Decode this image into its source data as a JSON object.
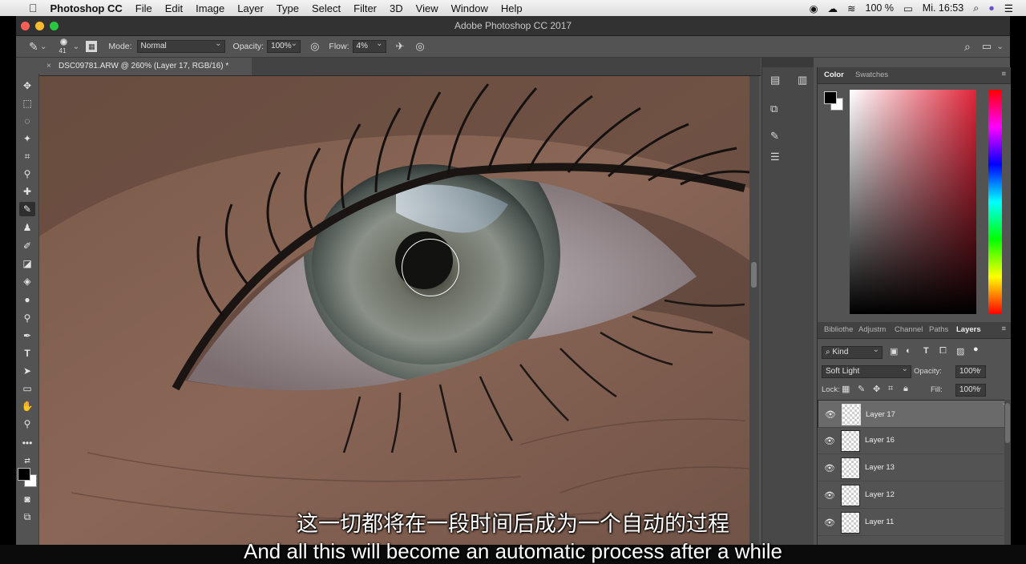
{
  "menubar": {
    "app": "Photoshop CC",
    "items": [
      "File",
      "Edit",
      "Image",
      "Layer",
      "Type",
      "Select",
      "Filter",
      "3D",
      "View",
      "Window",
      "Help"
    ],
    "battery": "100 %",
    "clock": "Mi. 16:53"
  },
  "window": {
    "title": "Adobe Photoshop CC 2017"
  },
  "options": {
    "brush_size": "41",
    "mode_label": "Mode:",
    "mode_value": "Normal",
    "opacity_label": "Opacity:",
    "opacity_value": "100%",
    "flow_label": "Flow:",
    "flow_value": "4%"
  },
  "document": {
    "tab_label": "DSC09781.ARW @ 260% (Layer 17, RGB/16) *"
  },
  "color_panel": {
    "tabs": [
      "Color",
      "Swatches"
    ]
  },
  "layers_panel": {
    "tabs": [
      "Bibliothe",
      "Adjustm",
      "Channel",
      "Paths",
      "Layers"
    ],
    "filter_label": "Kind",
    "blend_mode": "Soft Light",
    "opacity_label": "Opacity:",
    "opacity_value": "100%",
    "lock_label": "Lock:",
    "fill_label": "Fill:",
    "fill_value": "100%",
    "layers": [
      {
        "name": "Layer 17",
        "selected": true
      },
      {
        "name": "Layer 16",
        "selected": false
      },
      {
        "name": "Layer 13",
        "selected": false
      },
      {
        "name": "Layer 12",
        "selected": false
      },
      {
        "name": "Layer 11",
        "selected": false
      }
    ]
  },
  "subtitles": {
    "zh": "这一切都将在一段时间后成为一个自动的过程",
    "en": "And all this will become an automatic process after a while"
  },
  "colors": {
    "accent": "#e0253a",
    "panel": "#535353",
    "dark": "#323232"
  }
}
